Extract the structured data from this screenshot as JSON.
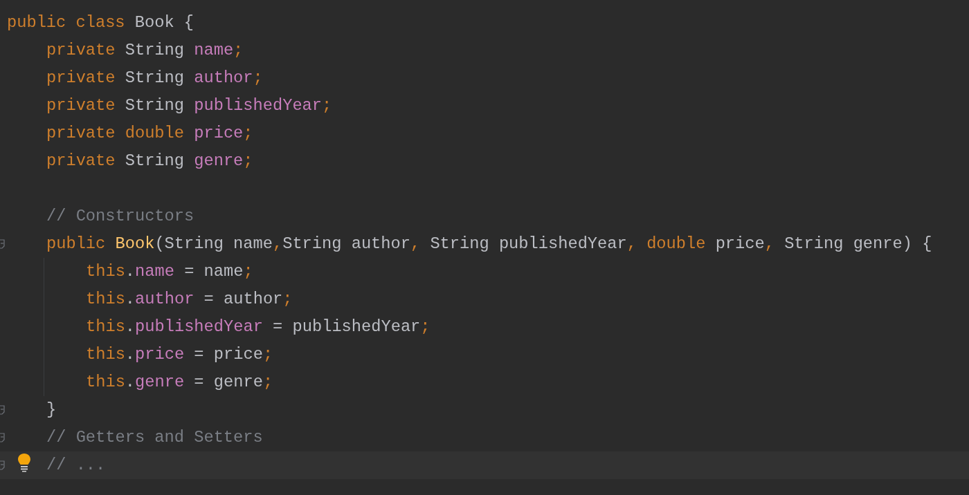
{
  "editor": {
    "lines": [
      {
        "kind": "code",
        "fold_marker": false,
        "intention": false,
        "tokens": [
          {
            "kind": "keyword",
            "text": "public class "
          },
          {
            "kind": "plain",
            "text": "Book {"
          }
        ],
        "children": [
          {
            "kind": "code",
            "fold_marker": false,
            "intention": false,
            "tokens": [
              {
                "kind": "keyword",
                "text": "private "
              },
              {
                "kind": "plain",
                "text": "String "
              },
              {
                "kind": "field",
                "text": "name"
              },
              {
                "kind": "keyword",
                "text": ";"
              }
            ]
          },
          {
            "kind": "code",
            "fold_marker": false,
            "intention": false,
            "tokens": [
              {
                "kind": "keyword",
                "text": "private "
              },
              {
                "kind": "plain",
                "text": "String "
              },
              {
                "kind": "field",
                "text": "author"
              },
              {
                "kind": "keyword",
                "text": ";"
              }
            ]
          },
          {
            "kind": "code",
            "fold_marker": false,
            "intention": false,
            "tokens": [
              {
                "kind": "keyword",
                "text": "private "
              },
              {
                "kind": "plain",
                "text": "String "
              },
              {
                "kind": "field",
                "text": "publishedYear"
              },
              {
                "kind": "keyword",
                "text": ";"
              }
            ]
          },
          {
            "kind": "code",
            "fold_marker": false,
            "intention": false,
            "tokens": [
              {
                "kind": "keyword",
                "text": "private double "
              },
              {
                "kind": "field",
                "text": "price"
              },
              {
                "kind": "keyword",
                "text": ";"
              }
            ]
          },
          {
            "kind": "code",
            "fold_marker": false,
            "intention": false,
            "tokens": [
              {
                "kind": "keyword",
                "text": "private "
              },
              {
                "kind": "plain",
                "text": "String "
              },
              {
                "kind": "field",
                "text": "genre"
              },
              {
                "kind": "keyword",
                "text": ";"
              }
            ]
          },
          {
            "kind": "blank",
            "fold_marker": false,
            "intention": false
          },
          {
            "kind": "code",
            "fold_marker": false,
            "intention": false,
            "tokens": [
              {
                "kind": "comment",
                "text": "// Constructors"
              }
            ]
          },
          {
            "kind": "code",
            "fold_marker": true,
            "intention": false,
            "tokens": [
              {
                "kind": "keyword",
                "text": "public "
              },
              {
                "kind": "method",
                "text": "Book"
              },
              {
                "kind": "plain",
                "text": "(String name"
              },
              {
                "kind": "keyword",
                "text": ","
              },
              {
                "kind": "plain",
                "text": "String author"
              },
              {
                "kind": "keyword",
                "text": ", "
              },
              {
                "kind": "plain",
                "text": "String publishedYear"
              },
              {
                "kind": "keyword",
                "text": ", double "
              },
              {
                "kind": "plain",
                "text": "price"
              },
              {
                "kind": "keyword",
                "text": ", "
              },
              {
                "kind": "plain",
                "text": "String genre) {"
              }
            ],
            "children": [
              {
                "kind": "code",
                "fold_marker": false,
                "intention": false,
                "tokens": [
                  {
                    "kind": "keyword",
                    "text": "this"
                  },
                  {
                    "kind": "plain",
                    "text": "."
                  },
                  {
                    "kind": "field",
                    "text": "name"
                  },
                  {
                    "kind": "plain",
                    "text": " = name"
                  },
                  {
                    "kind": "keyword",
                    "text": ";"
                  }
                ]
              },
              {
                "kind": "code",
                "fold_marker": false,
                "intention": false,
                "tokens": [
                  {
                    "kind": "keyword",
                    "text": "this"
                  },
                  {
                    "kind": "plain",
                    "text": "."
                  },
                  {
                    "kind": "field",
                    "text": "author"
                  },
                  {
                    "kind": "plain",
                    "text": " = author"
                  },
                  {
                    "kind": "keyword",
                    "text": ";"
                  }
                ]
              },
              {
                "kind": "code",
                "fold_marker": false,
                "intention": false,
                "tokens": [
                  {
                    "kind": "keyword",
                    "text": "this"
                  },
                  {
                    "kind": "plain",
                    "text": "."
                  },
                  {
                    "kind": "field",
                    "text": "publishedYear"
                  },
                  {
                    "kind": "plain",
                    "text": " = publishedYear"
                  },
                  {
                    "kind": "keyword",
                    "text": ";"
                  }
                ]
              },
              {
                "kind": "code",
                "fold_marker": false,
                "intention": false,
                "tokens": [
                  {
                    "kind": "keyword",
                    "text": "this"
                  },
                  {
                    "kind": "plain",
                    "text": "."
                  },
                  {
                    "kind": "field",
                    "text": "price"
                  },
                  {
                    "kind": "plain",
                    "text": " = price"
                  },
                  {
                    "kind": "keyword",
                    "text": ";"
                  }
                ]
              },
              {
                "kind": "code",
                "fold_marker": false,
                "intention": false,
                "tokens": [
                  {
                    "kind": "keyword",
                    "text": "this"
                  },
                  {
                    "kind": "plain",
                    "text": "."
                  },
                  {
                    "kind": "field",
                    "text": "genre"
                  },
                  {
                    "kind": "plain",
                    "text": " = genre"
                  },
                  {
                    "kind": "keyword",
                    "text": ";"
                  }
                ]
              }
            ]
          },
          {
            "kind": "code",
            "fold_marker": true,
            "intention": false,
            "tokens": [
              {
                "kind": "plain",
                "text": "}"
              }
            ]
          },
          {
            "kind": "code",
            "fold_marker": true,
            "intention": false,
            "tokens": [
              {
                "kind": "comment",
                "text": "// Getters and Setters"
              }
            ]
          },
          {
            "kind": "caret_line",
            "fold_marker": true,
            "intention": true,
            "tokens": [
              {
                "kind": "comment",
                "text": "// ..."
              }
            ]
          }
        ]
      }
    ]
  }
}
